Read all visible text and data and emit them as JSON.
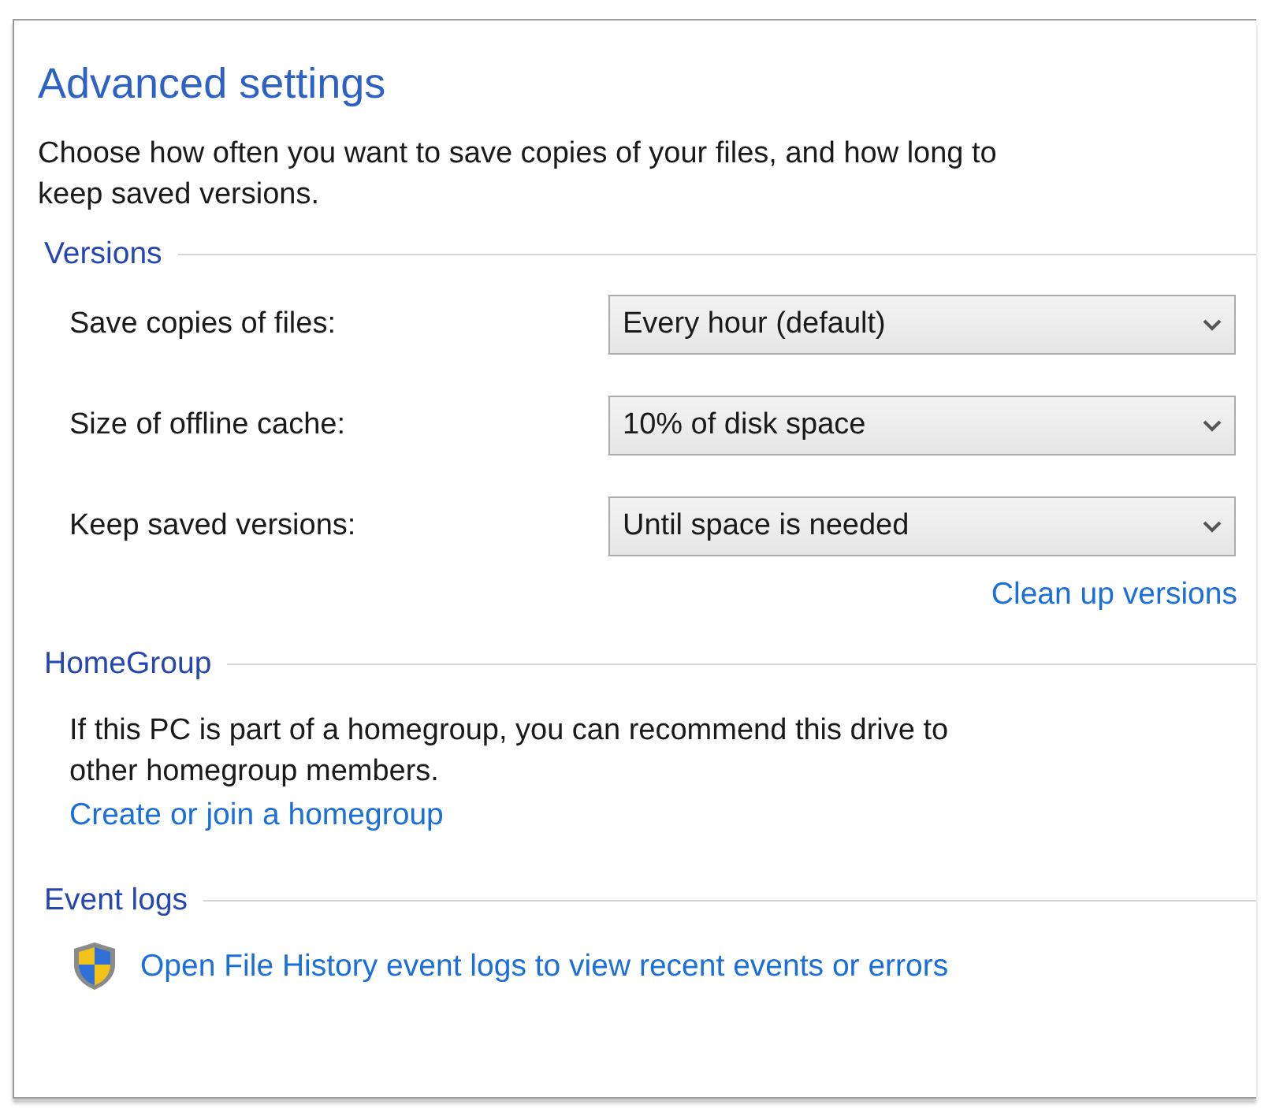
{
  "title": "Advanced settings",
  "intro": "Choose how often you want to save copies of your files, and how long to\nkeep saved versions.",
  "versions": {
    "heading": "Versions",
    "settings": [
      {
        "label": "Save copies of files:",
        "value": "Every hour (default)"
      },
      {
        "label": "Size of offline cache:",
        "value": "10% of disk space"
      },
      {
        "label": "Keep saved versions:",
        "value": "Until space is needed"
      }
    ],
    "link": "Clean up versions"
  },
  "homegroup": {
    "heading": "HomeGroup",
    "text": "If this PC is part of a homegroup, you can recommend this drive to\nother homegroup members.",
    "link": "Create or join a homegroup"
  },
  "event_logs": {
    "heading": "Event logs",
    "link": "Open File History event logs to view recent events or errors"
  }
}
